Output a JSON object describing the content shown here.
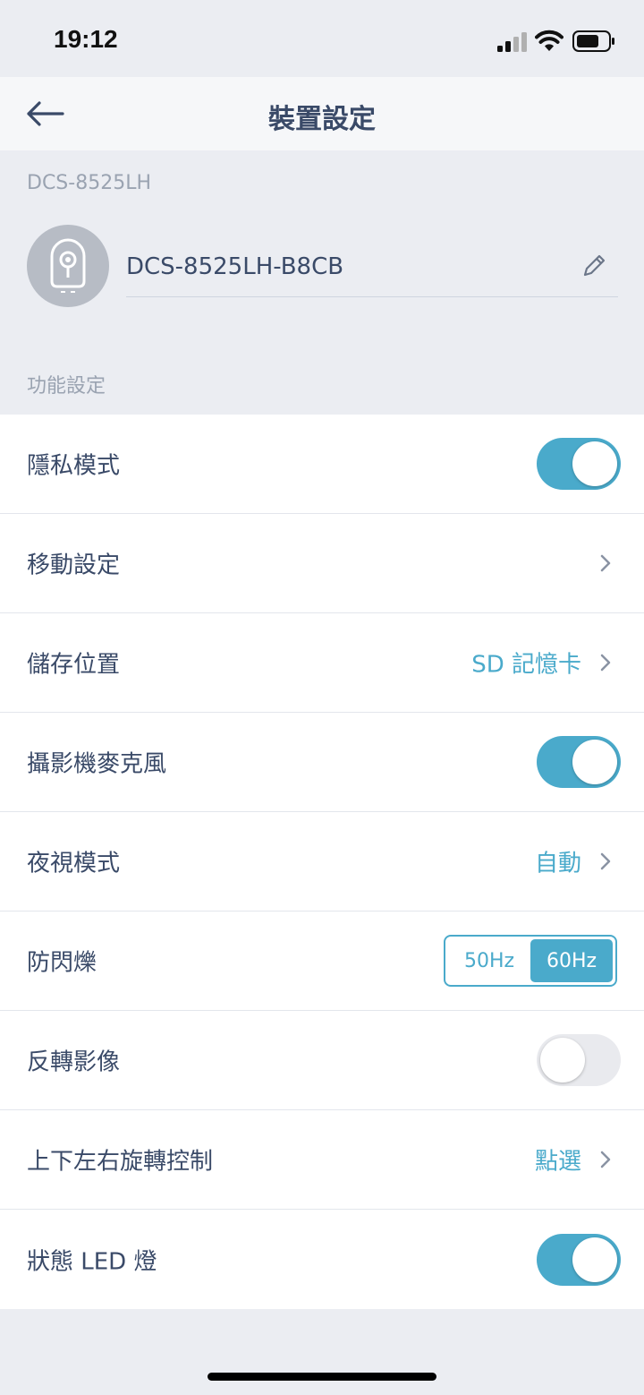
{
  "status_bar": {
    "time": "19:12"
  },
  "nav": {
    "title": "裝置設定",
    "back_icon": "arrow-left-icon"
  },
  "device": {
    "model": "DCS-8525LH",
    "name": "DCS-8525LH-B8CB",
    "edit_icon": "pencil-icon",
    "avatar_icon": "camera-icon"
  },
  "section": {
    "title": "功能設定"
  },
  "settings": {
    "privacy_mode": {
      "label": "隱私模式",
      "enabled": true
    },
    "motion_settings": {
      "label": "移動設定"
    },
    "storage_location": {
      "label": "儲存位置",
      "value": "SD 記憶卡"
    },
    "camera_microphone": {
      "label": "攝影機麥克風",
      "enabled": true
    },
    "night_vision": {
      "label": "夜視模式",
      "value": "自動"
    },
    "anti_flicker": {
      "label": "防閃爍",
      "options": [
        "50Hz",
        "60Hz"
      ],
      "selected": "60Hz"
    },
    "flip_image": {
      "label": "反轉影像",
      "enabled": false
    },
    "pan_tilt_control": {
      "label": "上下左右旋轉控制",
      "value": "點選"
    },
    "status_led": {
      "label": "狀態 LED 燈",
      "enabled": true
    }
  },
  "colors": {
    "accent": "#4aaacb",
    "text": "#3a4a68",
    "muted": "#9aa3b1",
    "background": "#ebedf2"
  }
}
